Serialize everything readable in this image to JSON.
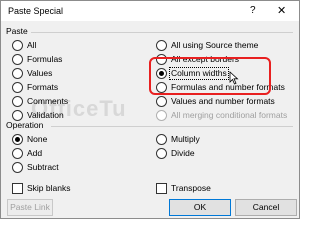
{
  "window": {
    "title": "Paste Special",
    "help_glyph": "?",
    "close_glyph": "✕"
  },
  "paste": {
    "label": "Paste",
    "left": [
      "All",
      "Formulas",
      "Values",
      "Formats",
      "Comments",
      "Validation"
    ],
    "right": [
      "All using Source theme",
      "All except borders",
      "Column widths",
      "Formulas and number formats",
      "Values and number formats",
      "All merging conditional formats"
    ],
    "selected": "Column widths"
  },
  "operation": {
    "label": "Operation",
    "left": [
      "None",
      "Add",
      "Subtract"
    ],
    "right": [
      "Multiply",
      "Divide"
    ],
    "selected": "None"
  },
  "options": {
    "skip_blanks": "Skip blanks",
    "transpose": "Transpose"
  },
  "buttons": {
    "paste_link": "Paste Link",
    "ok": "OK",
    "cancel": "Cancel"
  },
  "watermark": "OfficeTu",
  "colors": {
    "highlight": "#e82020",
    "ok_border": "#0078d7"
  }
}
